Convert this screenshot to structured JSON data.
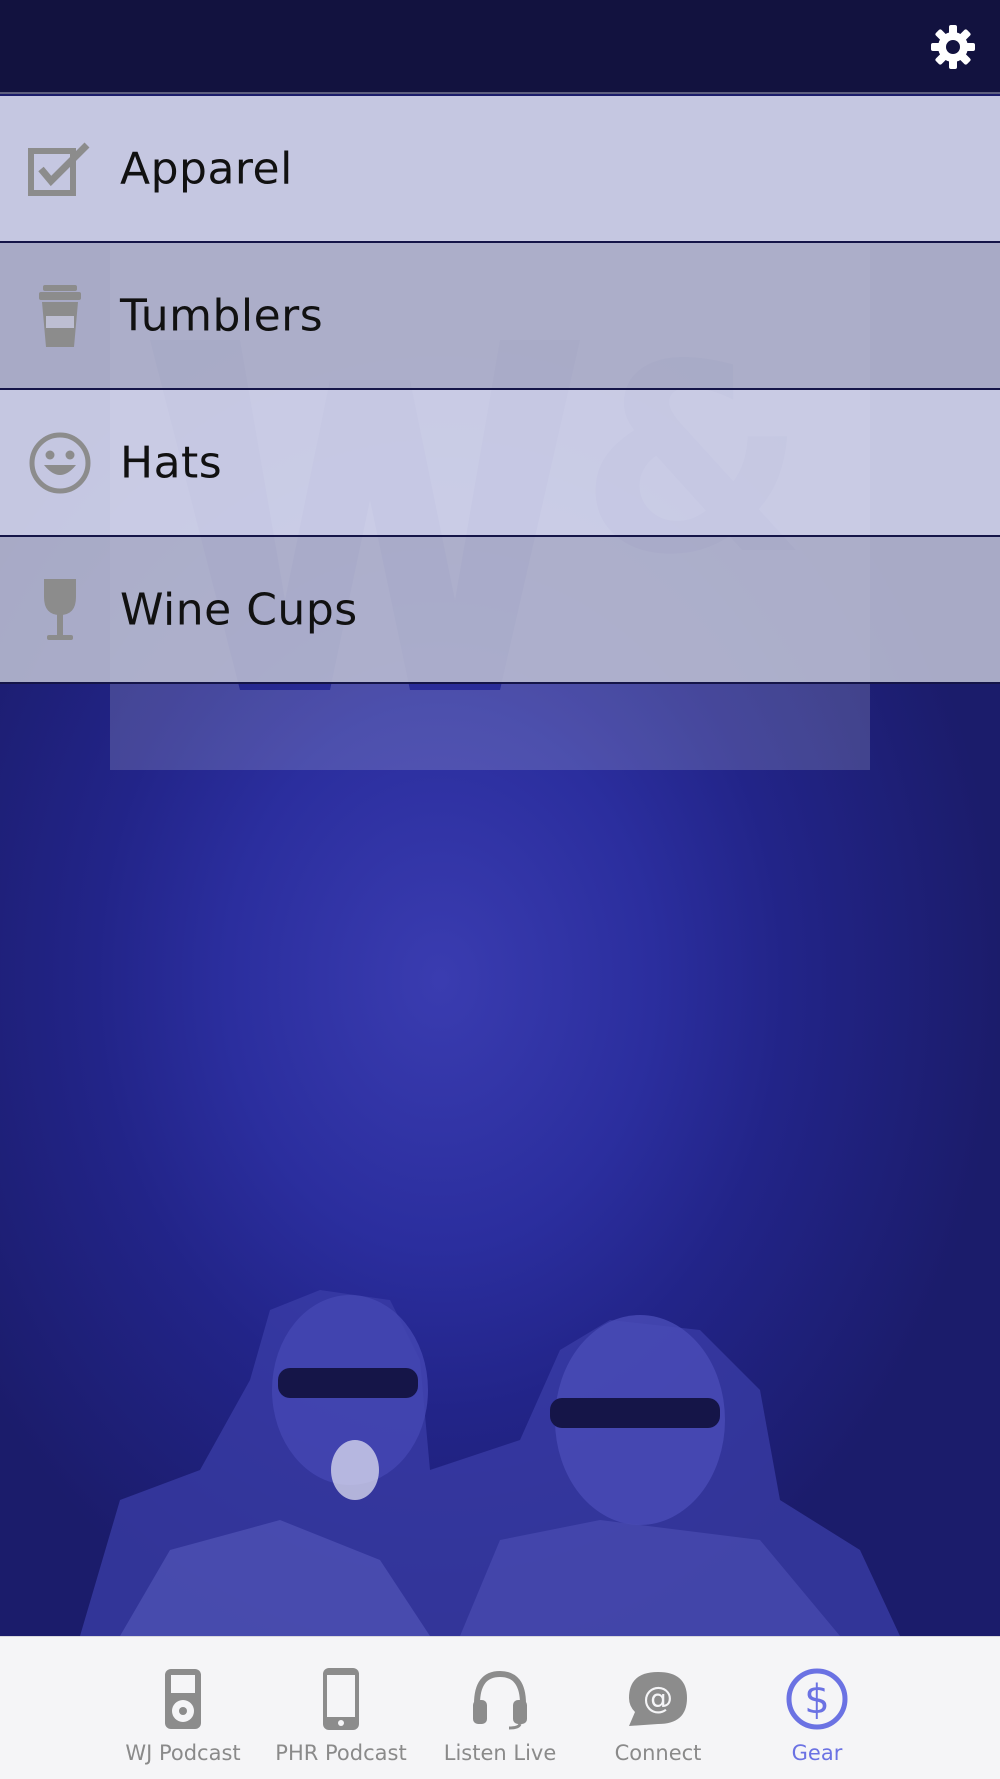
{
  "menu": {
    "items": [
      {
        "label": "Apparel",
        "icon": "checkbox-icon"
      },
      {
        "label": "Tumblers",
        "icon": "coffee-cup-icon"
      },
      {
        "label": "Hats",
        "icon": "smiley-face-icon"
      },
      {
        "label": "Wine Cups",
        "icon": "wine-glass-icon"
      }
    ]
  },
  "tabs": [
    {
      "label": "WJ Podcast",
      "icon": "ipod-icon"
    },
    {
      "label": "PHR Podcast",
      "icon": "phone-icon"
    },
    {
      "label": "Listen Live",
      "icon": "headphones-icon"
    },
    {
      "label": "Connect",
      "icon": "at-sign-icon"
    },
    {
      "label": "Gear",
      "icon": "dollar-icon",
      "active": true
    }
  ],
  "colors": {
    "topbar": "#12123f",
    "background": "#2b2e9e",
    "tab_active": "#6b72e3",
    "tab_inactive": "#8a8a8a"
  }
}
